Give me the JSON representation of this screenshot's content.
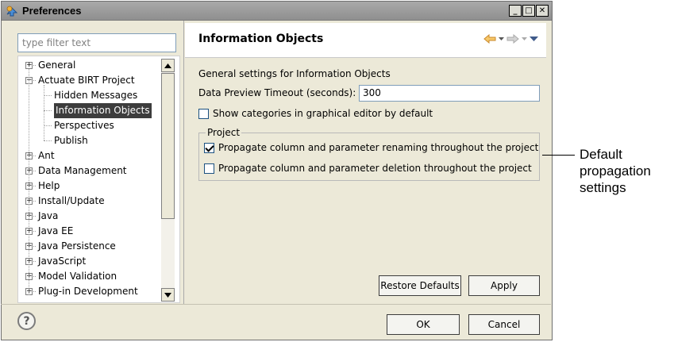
{
  "window": {
    "title": "Preferences",
    "minimize_symbol": "_",
    "maximize_symbol": "□",
    "close_symbol": "✕"
  },
  "filter": {
    "placeholder": "type filter text"
  },
  "tree": {
    "items": [
      {
        "label": "General",
        "expander": "+"
      },
      {
        "label": "Actuate BIRT Project",
        "expander": "−"
      },
      {
        "label": "Hidden Messages"
      },
      {
        "label": "Information Objects",
        "selected": true
      },
      {
        "label": "Perspectives"
      },
      {
        "label": "Publish"
      },
      {
        "label": "Ant",
        "expander": "+"
      },
      {
        "label": "Data Management",
        "expander": "+"
      },
      {
        "label": "Help",
        "expander": "+"
      },
      {
        "label": "Install/Update",
        "expander": "+"
      },
      {
        "label": "Java",
        "expander": "+"
      },
      {
        "label": "Java EE",
        "expander": "+"
      },
      {
        "label": "Java Persistence",
        "expander": "+"
      },
      {
        "label": "JavaScript",
        "expander": "+"
      },
      {
        "label": "Model Validation",
        "expander": "+"
      },
      {
        "label": "Plug-in Development",
        "expander": "+"
      }
    ]
  },
  "page": {
    "title": "Information Objects",
    "description": "General settings for Information Objects",
    "timeout_label": "Data Preview Timeout (seconds):",
    "timeout_value": "300",
    "show_categories_label": "Show categories in graphical editor by default",
    "show_categories_checked": false,
    "project_group_label": "Project",
    "propagate_renaming_label": "Propagate column and parameter renaming throughout the project",
    "propagate_renaming_checked": true,
    "propagate_deletion_label": "Propagate column and parameter deletion throughout the project",
    "propagate_deletion_checked": false
  },
  "buttons": {
    "restore_defaults": "Restore Defaults",
    "apply": "Apply",
    "ok": "OK",
    "cancel": "Cancel",
    "help": "?"
  },
  "callout": {
    "line1": "Default",
    "line2": "propagation",
    "line3": "settings"
  },
  "colors": {
    "nav_back_arrow": "#e8a33a",
    "selection_bg": "#3d3d3d",
    "dialog_bg": "#ece9d8"
  }
}
